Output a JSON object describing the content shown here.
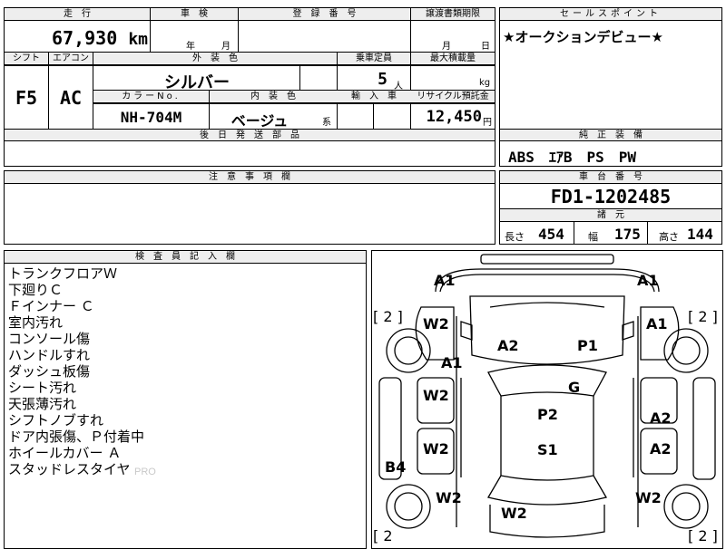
{
  "header": {
    "mileage_label": "走　行",
    "inspection_label": "車　検",
    "registration_label": "登　録　番　号",
    "transfer_deadline_label": "譲渡書類期限",
    "sales_point_label": "セールスポイント"
  },
  "mileage": {
    "value": "67,930",
    "unit": "km"
  },
  "inspection": {
    "year": "年",
    "month": "月"
  },
  "transfer_deadline": {
    "month": "月",
    "day": "日"
  },
  "sales_point": {
    "text": "★オークションデビュー★"
  },
  "shift": {
    "label": "シフト",
    "value": "F5"
  },
  "aircon": {
    "label": "エアコン",
    "value": "AC"
  },
  "exterior_color": {
    "label": "外　装　色",
    "value": "シルバー"
  },
  "capacity": {
    "label": "乗車定員",
    "value": "5",
    "unit": "人"
  },
  "max_load": {
    "label": "最大積載量",
    "unit": "kg"
  },
  "color_no": {
    "label": "カラーNo.",
    "value": "NH-704M"
  },
  "interior_color": {
    "label": "内　装　色",
    "value": "ベージュ",
    "suffix": "系"
  },
  "import": {
    "label": "輸　入　車"
  },
  "recycle": {
    "label": "リサイクル預託金",
    "value": "12,450",
    "unit": "円"
  },
  "later_parts": {
    "label": "後　日　発　送　部　品"
  },
  "standard_equipment": {
    "label": "純　正　装　備",
    "value": "ABS　ｴｱB　PS　PW"
  },
  "notes": {
    "label": "注　意　事　項　欄"
  },
  "chassis": {
    "label": "車　台　番　号",
    "value": "FD1-1202485"
  },
  "dimensions": {
    "label": "諸　元",
    "length_label": "長さ",
    "length": "454",
    "width_label": "幅",
    "width": "175",
    "height_label": "高さ",
    "height": "144"
  },
  "inspector": {
    "label": "検　査　員　記　入　欄",
    "lines": [
      "トランクフロアＷ",
      "下廻りＣ",
      "Ｆインナー Ｃ",
      "室内汚れ",
      "コンソール傷",
      "ハンドルすれ",
      "ダッシュ板傷",
      "シート汚れ",
      "天張薄汚れ",
      "シフトノブすれ",
      "ドア内張傷、Ｐ付着中",
      "ホイールカバー Ａ",
      "スタッドレスタイヤ"
    ]
  },
  "diagram": {
    "marks": [
      "A1",
      "A1",
      "W2",
      "A1",
      "A2",
      "P1",
      "A1",
      "G",
      "W2",
      "P2",
      "A2",
      "W2",
      "S1",
      "A2",
      "B4",
      "W2",
      "W2",
      "W2"
    ],
    "tire_tl": "[ 2 ]",
    "tire_tr": "[ 2 ]",
    "tire_bl": "[ 2",
    "tire_br": "[ 2 ]"
  },
  "watermark": "PRO"
}
